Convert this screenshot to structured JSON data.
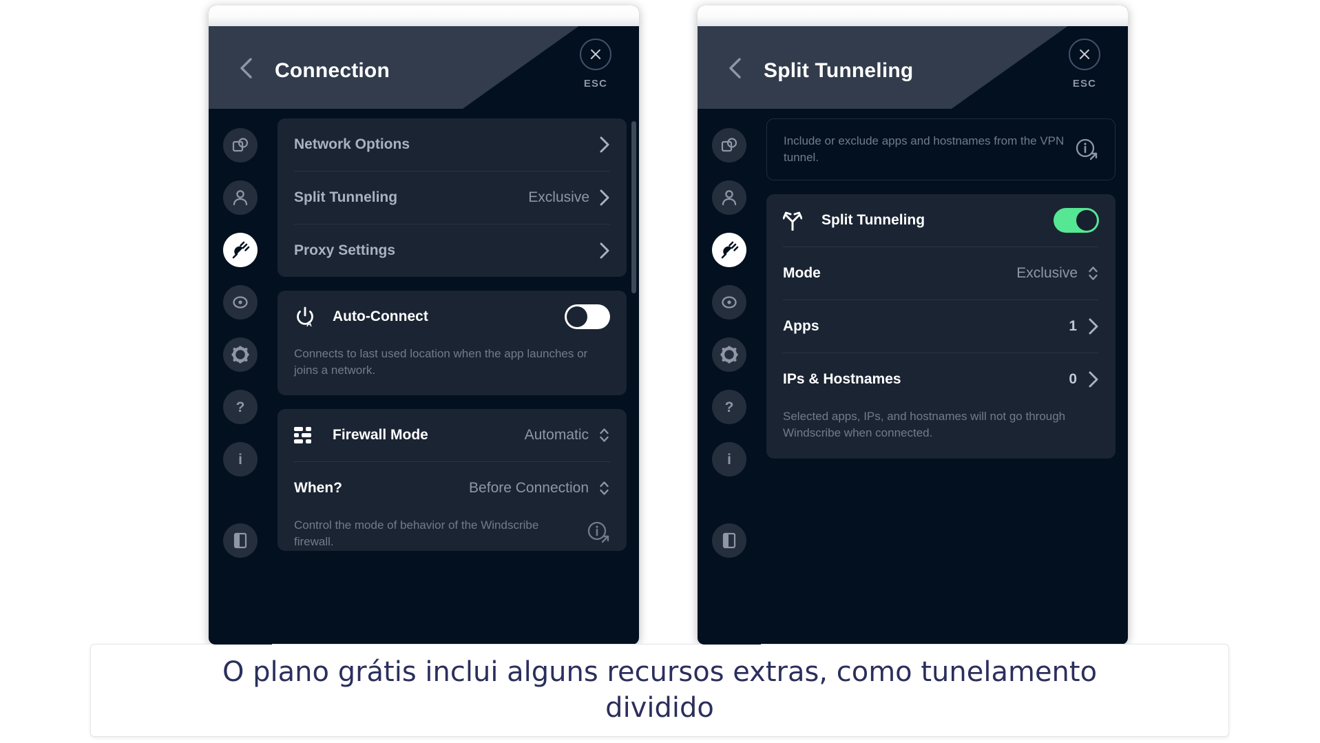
{
  "caption": {
    "text": "O plano grátis inclui alguns recursos extras, como tunelamento dividido"
  },
  "colors": {
    "accent_green": "#55e793",
    "panel_bg": "#02101f",
    "card_bg": "#1b2433",
    "header_band": "#323c4c",
    "caption_text": "#2b2f5c"
  },
  "rail": {
    "items": [
      {
        "name": "general",
        "icon": "general-shapes-icon",
        "active": false
      },
      {
        "name": "account",
        "icon": "account-person-icon",
        "active": false
      },
      {
        "name": "connection",
        "icon": "connection-plug-icon",
        "active": true
      },
      {
        "name": "robert",
        "icon": "robert-eye-icon",
        "active": false
      },
      {
        "name": "preferences",
        "icon": "gear-icon",
        "active": false
      },
      {
        "name": "help",
        "icon": "question-mark-icon",
        "active": false
      },
      {
        "name": "about",
        "icon": "info-letter-icon",
        "active": false
      },
      {
        "name": "logout",
        "icon": "exit-door-icon",
        "active": false
      }
    ]
  },
  "left_panel": {
    "header": {
      "title": "Connection",
      "back_icon": "chevron-left-icon",
      "close_icon": "close-x-icon",
      "esc_label": "ESC"
    },
    "settings_card": {
      "rows": [
        {
          "label": "Network Options",
          "value": "",
          "chevron": true
        },
        {
          "label": "Split Tunneling",
          "value": "Exclusive",
          "chevron": true
        },
        {
          "label": "Proxy Settings",
          "value": "",
          "chevron": true
        }
      ]
    },
    "auto_connect_card": {
      "icon": "power-auto-icon",
      "label": "Auto-Connect",
      "toggle_state": "off",
      "description": "Connects to last used location when the app launches or joins a network."
    },
    "firewall_card": {
      "icon": "firewall-bars-icon",
      "label": "Firewall Mode",
      "value": "Automatic",
      "when_label": "When?",
      "when_value": "Before Connection",
      "description": "Control the mode of behavior of the Windscribe firewall.",
      "info_icon": "info-external-link-icon"
    }
  },
  "right_panel": {
    "header": {
      "title": "Split Tunneling",
      "back_icon": "chevron-left-icon",
      "close_icon": "close-x-icon",
      "esc_label": "ESC"
    },
    "info_card": {
      "description": "Include or exclude apps and hostnames from the VPN tunnel.",
      "info_icon": "info-external-link-icon"
    },
    "main_card": {
      "title_icon": "split-tunnel-fork-icon",
      "title": "Split Tunneling",
      "toggle_state": "on",
      "rows": [
        {
          "label": "Mode",
          "value": "Exclusive",
          "control": "stepper"
        },
        {
          "label": "Apps",
          "value": "1",
          "control": "chevron"
        },
        {
          "label": "IPs & Hostnames",
          "value": "0",
          "control": "chevron"
        }
      ],
      "description": "Selected apps, IPs, and hostnames will not go through Windscribe when connected."
    }
  }
}
